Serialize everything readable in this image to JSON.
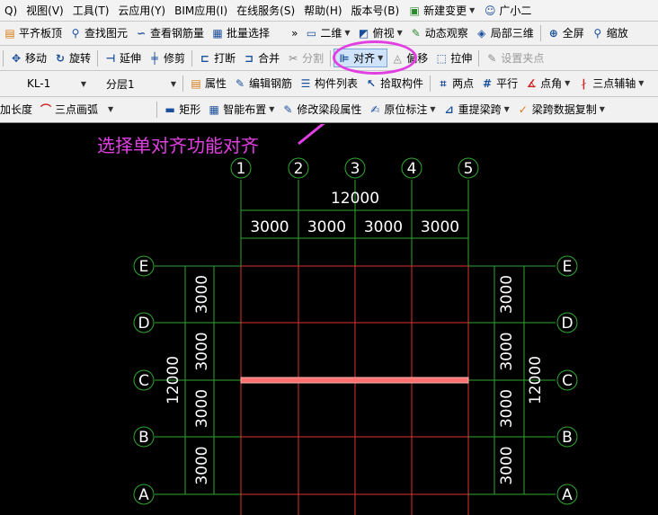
{
  "menu": {
    "item_q": "Q)",
    "view": "视图(V)",
    "tools": "工具(T)",
    "cloud": "云应用(Y)",
    "bim": "BIM应用(I)",
    "online": "在线服务(S)",
    "help": "帮助(H)",
    "version": "版本号(B)",
    "new_change": "新建变更",
    "assistant": "广小二"
  },
  "toolbar1": {
    "flat_slab": "平齐板顶",
    "find_element": "查找图元",
    "view_rebar": "查看钢筋量",
    "batch_select": "批量选择",
    "more": "»",
    "view_2d": "二维",
    "top_view": "俯视",
    "dynamic_view": "动态观察",
    "local_3d": "局部三维",
    "fullscreen": "全屏",
    "zoom": "缩放"
  },
  "toolbar2": {
    "move": "移动",
    "rotate": "旋转",
    "extend": "延伸",
    "trim": "修剪",
    "break": "打断",
    "merge": "合并",
    "split": "分割",
    "align": "对齐",
    "offset": "偏移",
    "stretch": "拉伸",
    "set_grip": "设置夹点"
  },
  "toolbar3": {
    "component_value": "KL-1",
    "layer_value": "分层1",
    "properties": "属性",
    "edit_rebar": "编辑钢筋",
    "component_list": "构件列表",
    "pick_component": "拾取构件",
    "two_point": "两点",
    "parallel": "平行",
    "point_angle": "点角",
    "three_point_axis": "三点辅轴"
  },
  "toolbar4": {
    "length": "加长度",
    "three_point_arc": "三点画弧",
    "rectangle": "矩形",
    "smart_layout": "智能布置",
    "modify_span": "修改梁段属性",
    "in_situ_mark": "原位标注",
    "reextract_span": "重提梁跨",
    "copy_span_data": "梁跨数据复制"
  },
  "annotation": "选择单对齐功能对齐",
  "drawing": {
    "grid_cols": [
      "1",
      "2",
      "3",
      "4",
      "5"
    ],
    "grid_rows": [
      "E",
      "D",
      "C",
      "B",
      "A"
    ],
    "total_width": "12000",
    "total_height": "12000",
    "col_spacings": [
      "3000",
      "3000",
      "3000",
      "3000"
    ],
    "row_spacings": [
      "3000",
      "3000",
      "3000",
      "3000"
    ]
  },
  "colors": {
    "highlight": "#e23fe3",
    "grid_line": "#e03030",
    "beam": "#ff7070",
    "dim_line": "#2fa82f",
    "text": "#ffffff"
  }
}
